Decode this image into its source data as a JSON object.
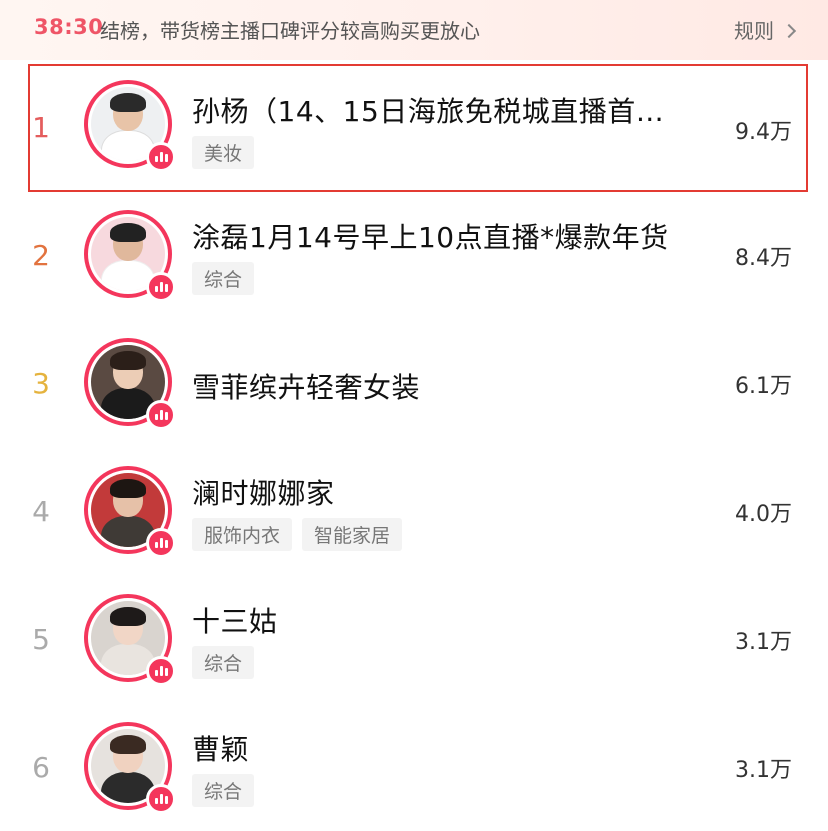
{
  "topbar": {
    "timer": "38:30",
    "notice": "结榜，带货榜主播口碑评分较高购买更放心",
    "rules_label": "规则"
  },
  "rank_colors": {
    "1": "#e45d5d",
    "2": "#e2733f",
    "3": "#e5b33e",
    "other": "#aaaaaa"
  },
  "entries": [
    {
      "rank": "1",
      "name": "孙杨（14、15日海旅免税城直播首…",
      "tags": [
        "美妆"
      ],
      "fans": "9.4万"
    },
    {
      "rank": "2",
      "name": "涂磊1月14号早上10点直播*爆款年货",
      "tags": [
        "综合"
      ],
      "fans": "8.4万"
    },
    {
      "rank": "3",
      "name": "雪菲缤卉轻奢女装",
      "tags": [],
      "fans": "6.1万"
    },
    {
      "rank": "4",
      "name": "澜时娜娜家",
      "tags": [
        "服饰内衣",
        "智能家居"
      ],
      "fans": "4.0万"
    },
    {
      "rank": "5",
      "name": "十三姑",
      "tags": [
        "综合"
      ],
      "fans": "3.1万"
    },
    {
      "rank": "6",
      "name": "曹颖",
      "tags": [
        "综合"
      ],
      "fans": "3.1万"
    }
  ]
}
